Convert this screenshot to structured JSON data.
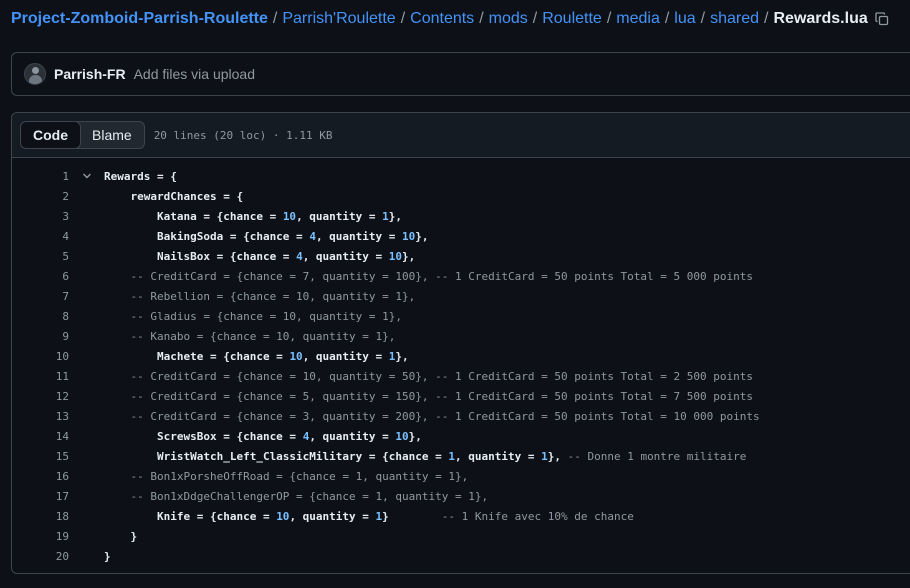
{
  "breadcrumb": {
    "repo": "Project-Zomboid-Parrish-Roulette",
    "path": [
      "Parrish'Roulette",
      "Contents",
      "mods",
      "Roulette",
      "media",
      "lua",
      "shared"
    ],
    "file": "Rewards.lua",
    "separator": "/"
  },
  "commit": {
    "author": "Parrish-FR",
    "message": "Add files via upload"
  },
  "file_header": {
    "tab_code": "Code",
    "tab_blame": "Blame",
    "meta": "20 lines (20 loc) · 1.11 KB"
  },
  "code_lines": [
    {
      "n": "1",
      "segs": [
        {
          "t": "Rewards = {"
        }
      ]
    },
    {
      "n": "2",
      "segs": [
        {
          "t": "    rewardChances = {"
        }
      ]
    },
    {
      "n": "3",
      "segs": [
        {
          "t": "        Katana = {chance = "
        },
        {
          "t": "10",
          "c": "num"
        },
        {
          "t": ", quantity = "
        },
        {
          "t": "1",
          "c": "num"
        },
        {
          "t": "},"
        }
      ]
    },
    {
      "n": "4",
      "segs": [
        {
          "t": "        BakingSoda = {chance = "
        },
        {
          "t": "4",
          "c": "num"
        },
        {
          "t": ", quantity = "
        },
        {
          "t": "10",
          "c": "num"
        },
        {
          "t": "},"
        }
      ]
    },
    {
      "n": "5",
      "segs": [
        {
          "t": "        NailsBox = {chance = "
        },
        {
          "t": "4",
          "c": "num"
        },
        {
          "t": ", quantity = "
        },
        {
          "t": "10",
          "c": "num"
        },
        {
          "t": "},"
        }
      ]
    },
    {
      "n": "6",
      "segs": [
        {
          "t": "    -- CreditCard = {chance = 7, quantity = 100}, -- 1 CreditCard = 50 points Total = 5 000 points",
          "c": "cm"
        }
      ]
    },
    {
      "n": "7",
      "segs": [
        {
          "t": "    -- Rebellion = {chance = 10, quantity = 1},",
          "c": "cm"
        }
      ]
    },
    {
      "n": "8",
      "segs": [
        {
          "t": "    -- Gladius = {chance = 10, quantity = 1},",
          "c": "cm"
        }
      ]
    },
    {
      "n": "9",
      "segs": [
        {
          "t": "    -- Kanabo = {chance = 10, quantity = 1},",
          "c": "cm"
        }
      ]
    },
    {
      "n": "10",
      "segs": [
        {
          "t": "        Machete = {chance = "
        },
        {
          "t": "10",
          "c": "num"
        },
        {
          "t": ", quantity = "
        },
        {
          "t": "1",
          "c": "num"
        },
        {
          "t": "},"
        }
      ]
    },
    {
      "n": "11",
      "segs": [
        {
          "t": "    -- CreditCard = {chance = 10, quantity = 50}, -- 1 CreditCard = 50 points Total = 2 500 points",
          "c": "cm"
        }
      ]
    },
    {
      "n": "12",
      "segs": [
        {
          "t": "    -- CreditCard = {chance = 5, quantity = 150}, -- 1 CreditCard = 50 points Total = 7 500 points",
          "c": "cm"
        }
      ]
    },
    {
      "n": "13",
      "segs": [
        {
          "t": "    -- CreditCard = {chance = 3, quantity = 200}, -- 1 CreditCard = 50 points Total = 10 000 points",
          "c": "cm"
        }
      ]
    },
    {
      "n": "14",
      "segs": [
        {
          "t": "        ScrewsBox = {chance = "
        },
        {
          "t": "4",
          "c": "num"
        },
        {
          "t": ", quantity = "
        },
        {
          "t": "10",
          "c": "num"
        },
        {
          "t": "},"
        }
      ]
    },
    {
      "n": "15",
      "segs": [
        {
          "t": "        WristWatch_Left_ClassicMilitary = {chance = "
        },
        {
          "t": "1",
          "c": "num"
        },
        {
          "t": ", quantity = "
        },
        {
          "t": "1",
          "c": "num"
        },
        {
          "t": "}, "
        },
        {
          "t": "-- Donne 1 montre militaire",
          "c": "cm"
        }
      ]
    },
    {
      "n": "16",
      "segs": [
        {
          "t": "    -- Bon1xPorsheOffRoad = {chance = 1, quantity = 1},",
          "c": "cm"
        }
      ]
    },
    {
      "n": "17",
      "segs": [
        {
          "t": "    -- Bon1xDdgeChallengerOP = {chance = 1, quantity = 1},",
          "c": "cm"
        }
      ]
    },
    {
      "n": "18",
      "segs": [
        {
          "t": "        Knife = {chance = "
        },
        {
          "t": "10",
          "c": "num"
        },
        {
          "t": ", quantity = "
        },
        {
          "t": "1",
          "c": "num"
        },
        {
          "t": "}        "
        },
        {
          "t": "-- 1 Knife avec 10% de chance",
          "c": "cm"
        }
      ]
    },
    {
      "n": "19",
      "segs": [
        {
          "t": "    }"
        }
      ]
    },
    {
      "n": "20",
      "segs": [
        {
          "t": "}"
        }
      ]
    }
  ],
  "icons": {
    "copy": "copy-icon",
    "fold": "chevron-down-icon",
    "avatar": "avatar"
  }
}
